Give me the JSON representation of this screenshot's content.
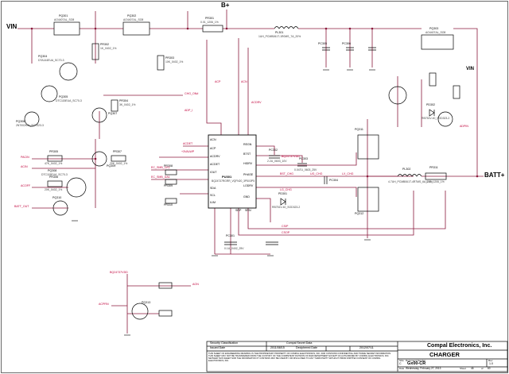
{
  "rails": {
    "vin": "VIN",
    "bplus": "B+",
    "batt": "BATT+",
    "vin_right": "VIN"
  },
  "chip": {
    "ref": "PU301",
    "part": "BQ24737RGRR_VQFN20_3P5X3P5"
  },
  "chip_pins_left": [
    "ACN",
    "ACP",
    "ACDRV",
    "ACDET",
    "IOUT",
    "SDA",
    "SCL",
    "ILIM"
  ],
  "chip_pins_right": [
    "REGN",
    "BTST",
    "HIDRV",
    "PHASE",
    "LODRV",
    "GND",
    "SRP",
    "SRN"
  ],
  "components": [
    {
      "ref": "PQ301",
      "val": "AO4407AL_SO8"
    },
    {
      "ref": "PQ302",
      "val": "AO4407AL_SO8"
    },
    {
      "ref": "PQ303",
      "val": "AO4407AL_SO8"
    },
    {
      "ref": "PR301",
      "val": "0.01_1206_1%"
    },
    {
      "ref": "PL301",
      "val": "1UH_PCMB061T-1R0MS_7A_20%"
    },
    {
      "ref": "PR302",
      "val": "1K_0402_1%"
    },
    {
      "ref": "PR303",
      "val": "10K_0402_1%"
    },
    {
      "ref": "PR304",
      "val": "3K_0402_1%"
    },
    {
      "ref": "PR305",
      "val": "47K_0402_1%"
    },
    {
      "ref": "PR306",
      "val": "20K_0402_1%"
    },
    {
      "ref": "PR307",
      "val": "20K_0402_1%"
    },
    {
      "ref": "PR308",
      "val": "10K_0402_1%"
    },
    {
      "ref": "PR309",
      "val": "47K_0402_1%"
    },
    {
      "ref": "PR310",
      "val": "100K_0402_1%"
    },
    {
      "ref": "PQ304",
      "val": "DTA144EUA_SC70-3"
    },
    {
      "ref": "PQ305",
      "val": "DTC115EUA_SC70-3"
    },
    {
      "ref": "PQ306",
      "val": "2N7002KW_SOT323-3"
    },
    {
      "ref": "PQ307",
      "val": "2N7002KW_SOT323-3"
    },
    {
      "ref": "PQ308",
      "val": "DTC115EUA_SC70-3"
    },
    {
      "ref": "PQ309",
      "val": "2N7002KW_SOT323-3"
    },
    {
      "ref": "PQ310",
      "val": "2N7002KW_SOT323-3"
    },
    {
      "ref": "PQ311",
      "val": "SI7686DP-T1-GE3"
    },
    {
      "ref": "PQ312",
      "val": "SI7716ADN-T1-GE3"
    },
    {
      "ref": "PQ313",
      "val": "2N7002KW_SOT323-3"
    },
    {
      "ref": "PL302",
      "val": "4.7UH_PCMB061T-4R7MS_6A_20%"
    },
    {
      "ref": "PR311",
      "val": "0.01_1206_1%"
    },
    {
      "ref": "PC301",
      "val": "0.1U_0402_25V"
    },
    {
      "ref": "PC302",
      "val": "2.2U_0603_10V"
    },
    {
      "ref": "PC303",
      "val": "0.047U_0603_25V"
    },
    {
      "ref": "PC304",
      "val": "0.1U_0402_25V"
    },
    {
      "ref": "PC305",
      "val": "10U_0805_25V"
    },
    {
      "ref": "PC306",
      "val": "10U_0805_25V"
    },
    {
      "ref": "PD301",
      "val": "RB751V-40_SOD323-2"
    },
    {
      "ref": "PD302",
      "val": "RB751V-40_SOD323-2"
    }
  ],
  "signals": {
    "acp": "ACP",
    "acn": "ACN",
    "adp_i": "ADP_I",
    "acdrv": "ACDRV",
    "acdet": "ACDET",
    "ec_smb_ck1": "EC_SMB_CK1",
    "ec_smb_da1": "EC_SMB_DA1",
    "bq_vdd": "BQ24737VDD",
    "bst": "BST_CHG",
    "ug": "UG_CHG",
    "lx": "LX_CHG",
    "lg": "LG_CHG",
    "csop": "CSOP",
    "csip": "CSIP",
    "acin": "ACIN",
    "acoff": "ACOFF",
    "pacin": "PACIN",
    "acprn": "ACPRN",
    "chg_on": "CHG_ON#",
    "batt_out": "BATT_OUT",
    "three_v": "+3VALWP",
    "aon": "AON",
    "adpin": "ADPIN",
    "bq_acok": "BQ24737VDD"
  },
  "title_block": {
    "security_label": "Security Classification",
    "security_value": "Compal Secret Data",
    "issued_label": "Issued Date",
    "issued_value": "2011/08/15",
    "deciphered_label": "Deciphered Date",
    "deciphered_value": "2012/07/11",
    "company": "Compal Electronics, Inc.",
    "title": "CHARGER",
    "doc_label": "Document Number",
    "doc_value": "Gx00-CR",
    "size_label": "Size",
    "size_value": "C",
    "rev_label": "Rev",
    "rev_value": "1.0",
    "date_label": "Date",
    "date_value": "Wednesday, February 27, 2013",
    "sheet_label": "Sheet",
    "sheet_value": "46",
    "of_label": "of",
    "of_value": "60",
    "notice": "THIS SHEET OF ENGINEERING DRAWING IS THE PROPRIETARY PROPERTY OF COMPAL ELECTRONICS, INC. AND CONTAINS CONFIDENTIAL AND TRADE SECRET INFORMATION. THIS SHEET MAY NOT BE TRANSFERED FROM THE CUSTODY OF THE COMPETENT DIVISION OF R&D DEPARTMENT EXCEPT AS AUTHORIZED BY COMPAL ELECTRONICS, INC. NEITHER THIS SHEET NOR THE INFORMATION IT CONTAINS MAY BE USED BY OR DISCLOSED TO ANY THIRD PARTY WITHOUT PRIOR WRITTEN CONSENT OF COMPAL ELECTRONICS, INC."
  },
  "colors": {
    "wire": "#8b1a3c",
    "part": "#000000",
    "net_label": "#c0003a",
    "highlight": "#e4003a"
  }
}
